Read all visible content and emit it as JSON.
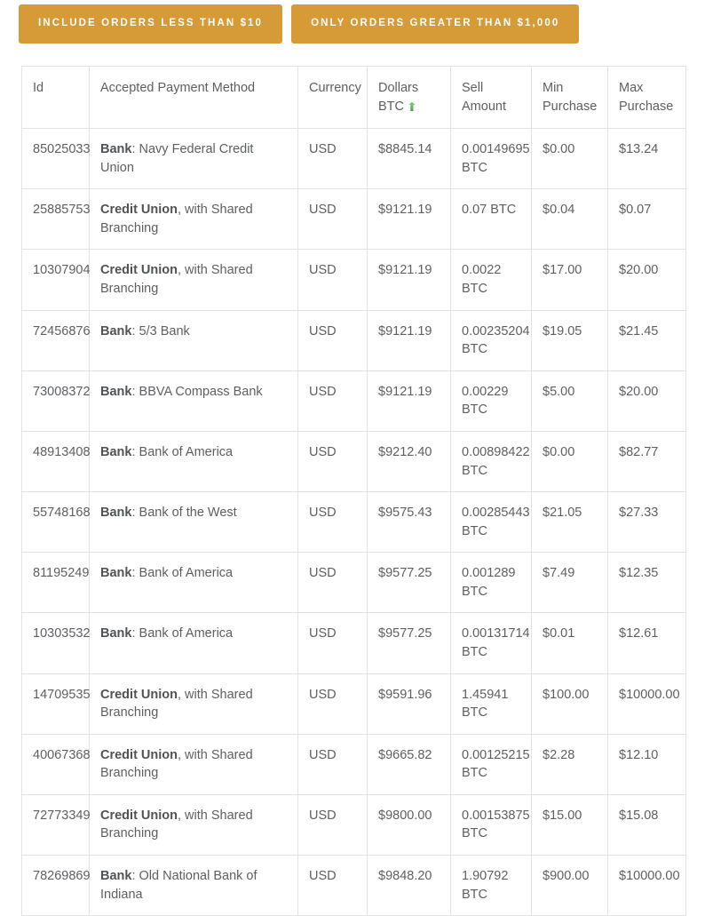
{
  "filters": {
    "buttons": [
      {
        "label": "Include orders less than $10",
        "name": "include-orders-less-than-10"
      },
      {
        "label": "Only orders greater than $1,000",
        "name": "only-orders-greater-than-1000"
      }
    ],
    "accent_color": "#d69b37",
    "accent_text_color": "#ffffff"
  },
  "table": {
    "sort": {
      "column": "Dollars BTC",
      "direction": "ascending",
      "icon": "arrow-up-icon",
      "glyph": "⬆",
      "color": "#5cb85c"
    },
    "columns": [
      {
        "label": "Id",
        "key": "id"
      },
      {
        "label": "Accepted Payment Method",
        "key": "method"
      },
      {
        "label": "Currency",
        "key": "currency"
      },
      {
        "label": "Dollars BTC",
        "key": "dollars_btc",
        "line1": "Dollars",
        "line2": "BTC",
        "sorted": true
      },
      {
        "label": "Sell Amount",
        "key": "sell_amount",
        "line1": "Sell",
        "line2": "Amount"
      },
      {
        "label": "Min Purchase",
        "key": "min_purchase",
        "line1": "Min",
        "line2": "Purchase"
      },
      {
        "label": "Max Purchase",
        "key": "max_purchase",
        "line1": "Max",
        "line2": "Purchase"
      }
    ],
    "rows": [
      {
        "id": "85025033",
        "method_type": "Bank",
        "method_rest": ": Navy Federal Credit Union",
        "currency": "USD",
        "dollars_btc": "$8845.14",
        "sell_amount": "0.00149695 BTC",
        "min_purchase": "$0.00",
        "max_purchase": "$13.24"
      },
      {
        "id": "25885753",
        "method_type": "Credit Union",
        "method_rest": ", with Shared Branching",
        "currency": "USD",
        "dollars_btc": "$9121.19",
        "sell_amount": "0.07 BTC",
        "min_purchase": "$0.04",
        "max_purchase": "$0.07"
      },
      {
        "id": "10307904",
        "method_type": "Credit Union",
        "method_rest": ", with Shared Branching",
        "currency": "USD",
        "dollars_btc": "$9121.19",
        "sell_amount": "0.0022 BTC",
        "min_purchase": "$17.00",
        "max_purchase": "$20.00"
      },
      {
        "id": "72456876",
        "method_type": "Bank",
        "method_rest": ": 5/3 Bank",
        "currency": "USD",
        "dollars_btc": "$9121.19",
        "sell_amount": "0.00235204 BTC",
        "min_purchase": "$19.05",
        "max_purchase": "$21.45"
      },
      {
        "id": "73008372",
        "method_type": "Bank",
        "method_rest": ": BBVA Compass Bank",
        "currency": "USD",
        "dollars_btc": "$9121.19",
        "sell_amount": "0.00229 BTC",
        "min_purchase": "$5.00",
        "max_purchase": "$20.00"
      },
      {
        "id": "48913408",
        "method_type": "Bank",
        "method_rest": ": Bank of America",
        "currency": "USD",
        "dollars_btc": "$9212.40",
        "sell_amount": "0.00898422 BTC",
        "min_purchase": "$0.00",
        "max_purchase": "$82.77"
      },
      {
        "id": "55748168",
        "method_type": "Bank",
        "method_rest": ": Bank of the West",
        "currency": "USD",
        "dollars_btc": "$9575.43",
        "sell_amount": "0.00285443 BTC",
        "min_purchase": "$21.05",
        "max_purchase": "$27.33"
      },
      {
        "id": "81195249",
        "method_type": "Bank",
        "method_rest": ": Bank of America",
        "currency": "USD",
        "dollars_btc": "$9577.25",
        "sell_amount": "0.001289 BTC",
        "min_purchase": "$7.49",
        "max_purchase": "$12.35"
      },
      {
        "id": "10303532",
        "method_type": "Bank",
        "method_rest": ": Bank of America",
        "currency": "USD",
        "dollars_btc": "$9577.25",
        "sell_amount": "0.00131714 BTC",
        "min_purchase": "$0.01",
        "max_purchase": "$12.61"
      },
      {
        "id": "14709535",
        "method_type": "Credit Union",
        "method_rest": ", with Shared Branching",
        "currency": "USD",
        "dollars_btc": "$9591.96",
        "sell_amount": "1.45941 BTC",
        "min_purchase": "$100.00",
        "max_purchase": "$10000.00"
      },
      {
        "id": "40067368",
        "method_type": "Credit Union",
        "method_rest": ", with Shared Branching",
        "currency": "USD",
        "dollars_btc": "$9665.82",
        "sell_amount": "0.00125215 BTC",
        "min_purchase": "$2.28",
        "max_purchase": "$12.10"
      },
      {
        "id": "72773349",
        "method_type": "Credit Union",
        "method_rest": ", with Shared Branching",
        "currency": "USD",
        "dollars_btc": "$9800.00",
        "sell_amount": "0.00153875 BTC",
        "min_purchase": "$15.00",
        "max_purchase": "$15.08"
      },
      {
        "id": "78269869",
        "method_type": "Bank",
        "method_rest": ": Old National Bank of Indiana",
        "currency": "USD",
        "dollars_btc": "$9848.20",
        "sell_amount": "1.90792 BTC",
        "min_purchase": "$900.00",
        "max_purchase": "$10000.00"
      }
    ]
  }
}
